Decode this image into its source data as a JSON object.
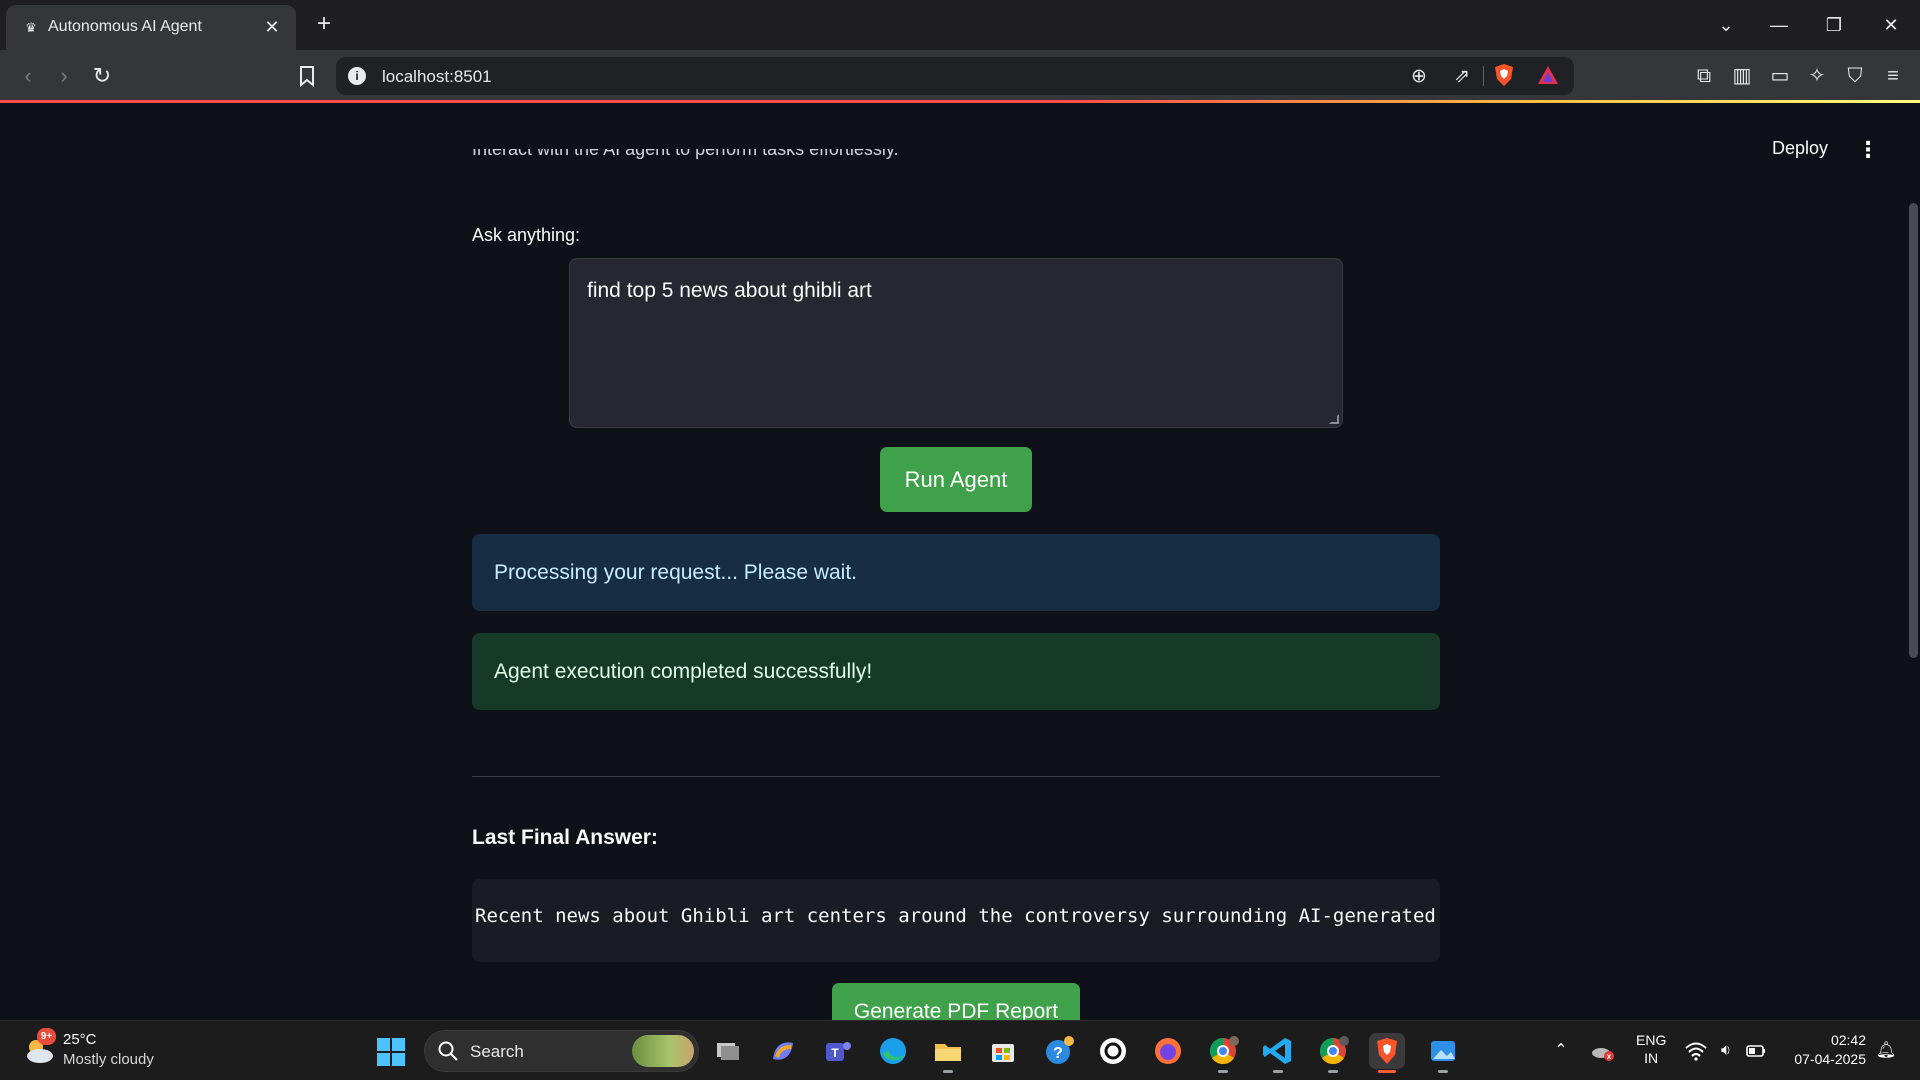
{
  "browser": {
    "tab_title": "Autonomous AI Agent",
    "url": "localhost:8501"
  },
  "app": {
    "deploy_label": "Deploy",
    "subtitle": "Interact with the AI agent to perform tasks effortlessly.",
    "ask_label": "Ask anything:",
    "query_value": "find top 5 news about ghibli art",
    "run_button": "Run Agent",
    "info_message": "Processing your request... Please wait.",
    "success_message": "Agent execution completed successfully!",
    "answer_heading": "Last Final Answer:",
    "answer_text": "Recent news about Ghibli art centers around the controversy surrounding AI-generated",
    "pdf_button": "Generate PDF Report",
    "colors": {
      "background": "#0e1117",
      "button_green": "#3fa14a",
      "info_bg": "#172d43",
      "success_bg": "#173928"
    }
  },
  "taskbar": {
    "weather_badge": "9+",
    "temperature": "25°C",
    "condition": "Mostly cloudy",
    "search_label": "Search",
    "lang_top": "ENG",
    "lang_bottom": "IN",
    "time": "02:42",
    "date": "07-04-2025"
  }
}
